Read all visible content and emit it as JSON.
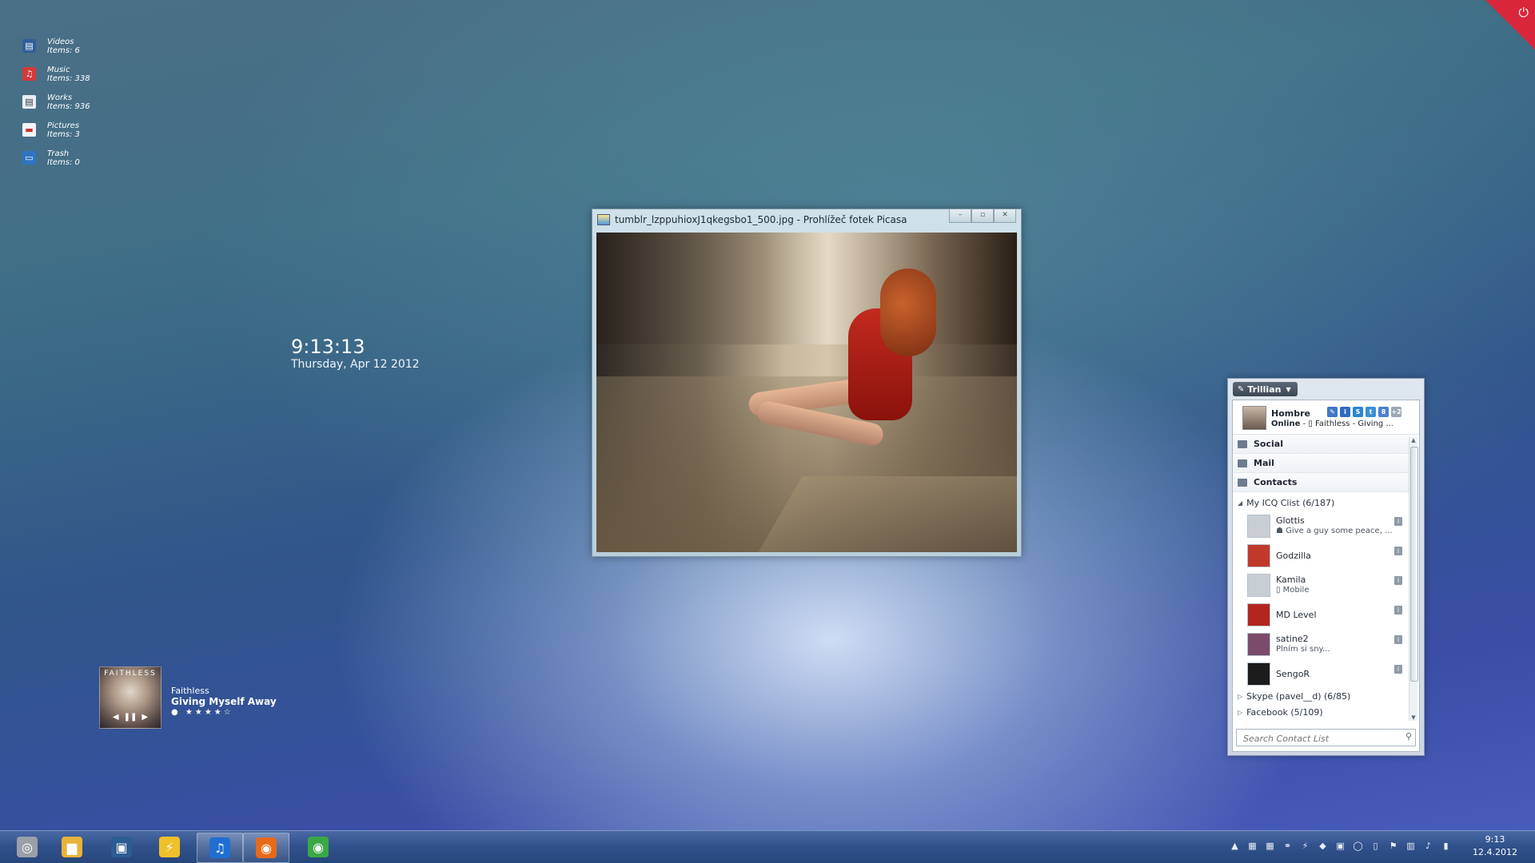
{
  "desktop": {
    "items": [
      {
        "name": "Videos",
        "count": "Items: 6",
        "icon": "video-icon"
      },
      {
        "name": "Music",
        "count": "Items: 338",
        "icon": "music-icon"
      },
      {
        "name": "Works",
        "count": "Items: 936",
        "icon": "document-icon"
      },
      {
        "name": "Pictures",
        "count": "Items: 3",
        "icon": "picture-icon"
      },
      {
        "name": "Trash",
        "count": "Items: 0",
        "icon": "trash-icon"
      }
    ]
  },
  "clock": {
    "time": "9:13:13",
    "date": "Thursday, Apr 12 2012"
  },
  "music": {
    "album_text": "FAITHLESS",
    "artist": "Faithless",
    "track": "Giving Myself Away",
    "rating": 4,
    "rating_max": 5,
    "controls": {
      "prev": "◀",
      "pause": "❚❚",
      "next": "▶"
    }
  },
  "picasa": {
    "title": "tumblr_lzppuhioxJ1qkegsbo1_500.jpg - Prohlížeč fotek Picasa",
    "buttons": {
      "minimize": "–",
      "maximize": "▫",
      "close": "✕"
    }
  },
  "trillian": {
    "menu": "Trillian",
    "profile": {
      "name": "Hombre",
      "status_label": "Online",
      "status_text": " - ▯ Faithless - Giving ...",
      "networks": [
        {
          "label": "✎",
          "color": "#3f78c8"
        },
        {
          "label": "i",
          "color": "#2f6bc0"
        },
        {
          "label": "S",
          "color": "#2a86d4"
        },
        {
          "label": "t",
          "color": "#3b8fd6"
        },
        {
          "label": "8",
          "color": "#4c7fcf"
        },
        {
          "label": "+2",
          "color": "#9aa7b6"
        }
      ]
    },
    "sections": [
      {
        "label": "Social"
      },
      {
        "label": "Mail"
      },
      {
        "label": "Contacts"
      }
    ],
    "groups": [
      {
        "label": "My ICQ Clist (6/187)",
        "expanded": "◢"
      },
      {
        "label": "Skype (pavel__d) (6/85)",
        "expanded": "▷"
      },
      {
        "label": "Facebook (5/109)",
        "expanded": "▷"
      }
    ],
    "contacts": [
      {
        "name": "Glottis",
        "status": "☗ Give a guy some peace, ...",
        "avatar": "#c9ced4"
      },
      {
        "name": "Godzilla",
        "status": "",
        "avatar": "#c0392b"
      },
      {
        "name": "Kamila",
        "status": "▯ Mobile",
        "avatar": "#c9ced4"
      },
      {
        "name": "MD Level",
        "status": "",
        "avatar": "#b3261e"
      },
      {
        "name": "satine2",
        "status": "Plním si sny...",
        "avatar": "#7a4c6a"
      },
      {
        "name": "SengoR",
        "status": "",
        "avatar": "#1c1c1c"
      }
    ],
    "info_label": "i",
    "search_placeholder": "Search Contact List"
  },
  "taskbar": {
    "apps": [
      {
        "name": "start",
        "glyph": "◎",
        "color": "#9aa0a8"
      },
      {
        "name": "explorer",
        "glyph": "▆",
        "color": "#e8b33a"
      },
      {
        "name": "window-app",
        "glyph": "▣",
        "color": "#2b5c92"
      },
      {
        "name": "winamp",
        "glyph": "⚡",
        "color": "#f0c02a"
      },
      {
        "name": "itunes",
        "glyph": "♫",
        "color": "#1f6fd2"
      },
      {
        "name": "firefox",
        "glyph": "◉",
        "color": "#e66a1a"
      },
      {
        "name": "chrome",
        "glyph": "◉",
        "color": "#3aa845"
      }
    ],
    "tray_icons": [
      "▲",
      "▦",
      "▦",
      "⚭",
      "⚡",
      "◆",
      "▣",
      "◯",
      "▯",
      "⚑",
      "▥",
      "♪",
      "▮"
    ],
    "time": "9:13",
    "date": "12.4.2012"
  },
  "power_glyph": "⏻"
}
